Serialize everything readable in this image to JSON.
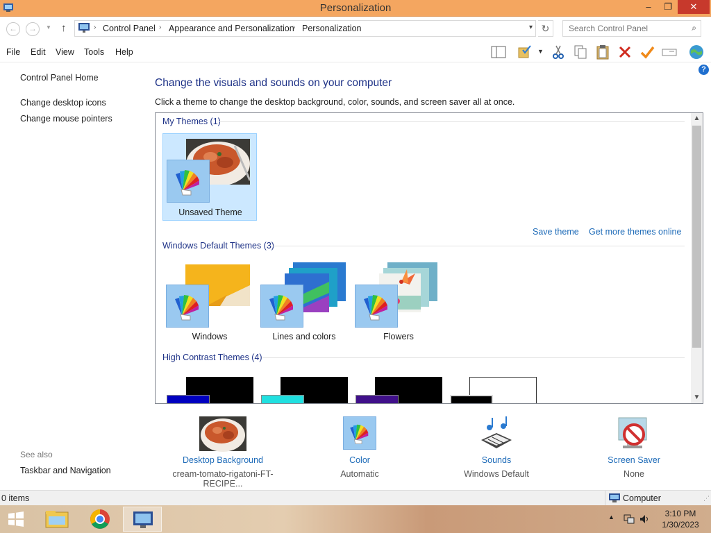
{
  "window": {
    "title": "Personalization",
    "controls": {
      "minimize": "–",
      "maximize": "❐",
      "close": "✕"
    }
  },
  "address": {
    "breadcrumbs": [
      "Control Panel",
      "Appearance and Personalization",
      "Personalization"
    ],
    "search_placeholder": "Search Control Panel"
  },
  "menu": [
    "File",
    "Edit",
    "View",
    "Tools",
    "Help"
  ],
  "toolbar_icons": [
    "layout-icon",
    "folder-check-icon",
    "scissors-icon",
    "copy-icon",
    "paste-icon",
    "delete-icon",
    "check-icon",
    "rename-icon",
    "globe-icon"
  ],
  "sidebar": {
    "links": [
      "Control Panel Home",
      "Change desktop icons",
      "Change mouse pointers"
    ],
    "see_also_label": "See also",
    "see_also_links": [
      "Taskbar and Navigation"
    ]
  },
  "main": {
    "heading": "Change the visuals and sounds on your computer",
    "subtext": "Click a theme to change the desktop background, color, sounds, and screen saver all at once.",
    "groups": {
      "my_themes": {
        "title": "My Themes (1)",
        "items": [
          {
            "name": "Unsaved Theme",
            "selected": true
          }
        ]
      },
      "links": {
        "save": "Save theme",
        "more": "Get more themes online"
      },
      "default_themes": {
        "title": "Windows Default Themes (3)",
        "items": [
          {
            "name": "Windows"
          },
          {
            "name": "Lines and colors"
          },
          {
            "name": "Flowers"
          }
        ]
      },
      "high_contrast": {
        "title": "High Contrast Themes (4)"
      }
    }
  },
  "settings": [
    {
      "label": "Desktop Background",
      "value": "cream-tomato-rigatoni-FT-RECIPE..."
    },
    {
      "label": "Color",
      "value": "Automatic"
    },
    {
      "label": "Sounds",
      "value": "Windows Default"
    },
    {
      "label": "Screen Saver",
      "value": "None"
    }
  ],
  "status": {
    "items": "0 items",
    "location": "Computer"
  },
  "clock": {
    "time": "3:10 PM",
    "date": "1/30/2023"
  },
  "colors": {
    "titlebar": "#f4a660",
    "close_button": "#c7392c",
    "link": "#1e6bb8",
    "heading": "#1e3287",
    "selection": "#cce8ff"
  }
}
